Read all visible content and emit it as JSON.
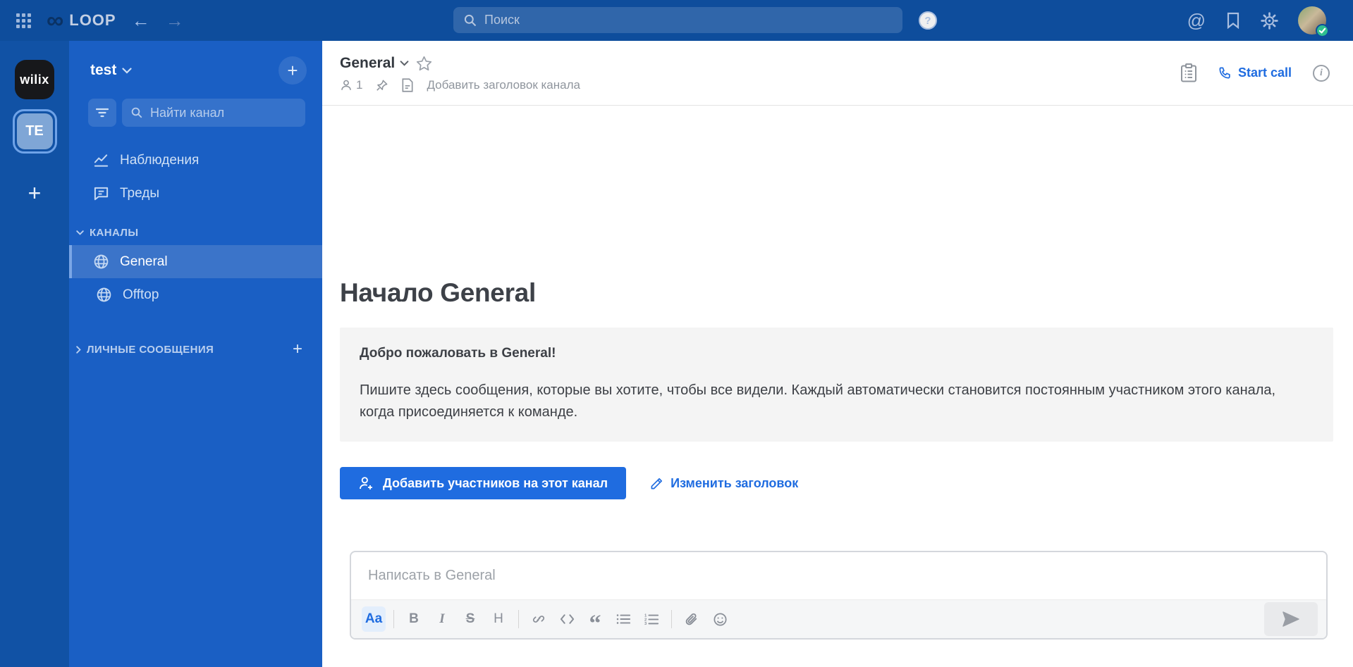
{
  "theme": {
    "topbar": "#0e4d9c",
    "rail": "#1152a5",
    "sidebar": "#1a5fc4",
    "sel": "#3b74c9",
    "sel-border": "#7aa6e6",
    "accent": "#1f6ce0",
    "online": "#2fbf8f",
    "textdark": "#3d4148",
    "muted": "#8f959d",
    "box": "#f4f4f4",
    "toolbar": "#f5f6f7"
  },
  "topbar": {
    "logo_glyph": "∞",
    "product_name": "LOOP",
    "back_arrow": "←",
    "forward_arrow": "→",
    "search_placeholder": "Поиск",
    "help_glyph": "?",
    "mentions_glyph": "@"
  },
  "team_sidebar": {
    "teams": [
      {
        "label": "wilix"
      },
      {
        "label": "TE",
        "selected": true
      }
    ],
    "add_label": "+"
  },
  "channel_sidebar": {
    "team_name": "test",
    "add_label": "+",
    "find_placeholder": "Найти канал",
    "menu_items": [
      {
        "label": "Наблюдения"
      },
      {
        "label": "Треды"
      }
    ],
    "channels_section": {
      "label": "КАНАЛЫ"
    },
    "channels": [
      {
        "label": "General",
        "selected": true
      },
      {
        "label": "Offtop"
      }
    ],
    "dm_section": {
      "label": "ЛИЧНЫЕ СООБЩЕНИЯ",
      "add_label": "+"
    }
  },
  "channel_header": {
    "title": "General",
    "member_count": "1",
    "header_placeholder": "Добавить заголовок канала",
    "start_call_label": "Start call",
    "info_glyph": "i"
  },
  "intro": {
    "title": "Начало General",
    "welcome_title": "Добро пожаловать в General!",
    "welcome_body": "Пишите здесь сообщения, которые вы хотите, чтобы все видели. Каждый автоматически становится постоянным участником этого канала, когда присоединяется к команде.",
    "add_members_label": "Добавить участников на этот канал",
    "edit_header_label": "Изменить заголовок"
  },
  "composer": {
    "placeholder": "Написать в General",
    "toolbar": {
      "format_label": "Aa",
      "bold_label": "B",
      "italic_label": "I",
      "strike_label": "S",
      "heading_label": "H",
      "quote_glyph": "“"
    }
  }
}
